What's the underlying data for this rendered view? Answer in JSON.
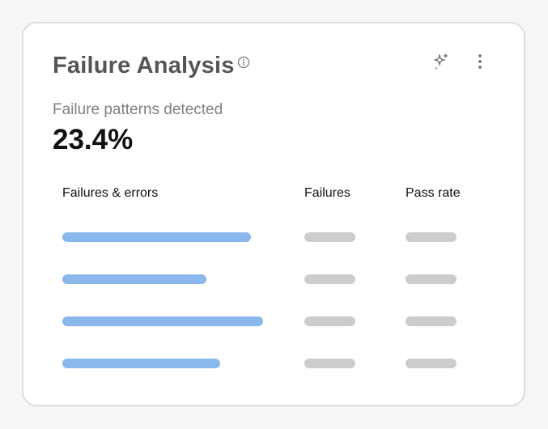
{
  "card": {
    "title": "Failure Analysis",
    "subtitle": "Failure patterns detected",
    "metric_value": "23.4%",
    "icons": {
      "info": "info-icon",
      "ai": "sparkle-icon",
      "menu": "more-vertical-icon"
    }
  },
  "table": {
    "columns": [
      "Failures & errors",
      "Failures",
      "Pass rate"
    ],
    "rows": [
      {
        "error_bar_fraction": 0.93
      },
      {
        "error_bar_fraction": 0.71
      },
      {
        "error_bar_fraction": 0.99
      },
      {
        "error_bar_fraction": 0.78
      }
    ]
  },
  "colors": {
    "bar": "#8ab8ec",
    "placeholder": "#cccccc",
    "title": "#555555",
    "metric": "#111111"
  }
}
